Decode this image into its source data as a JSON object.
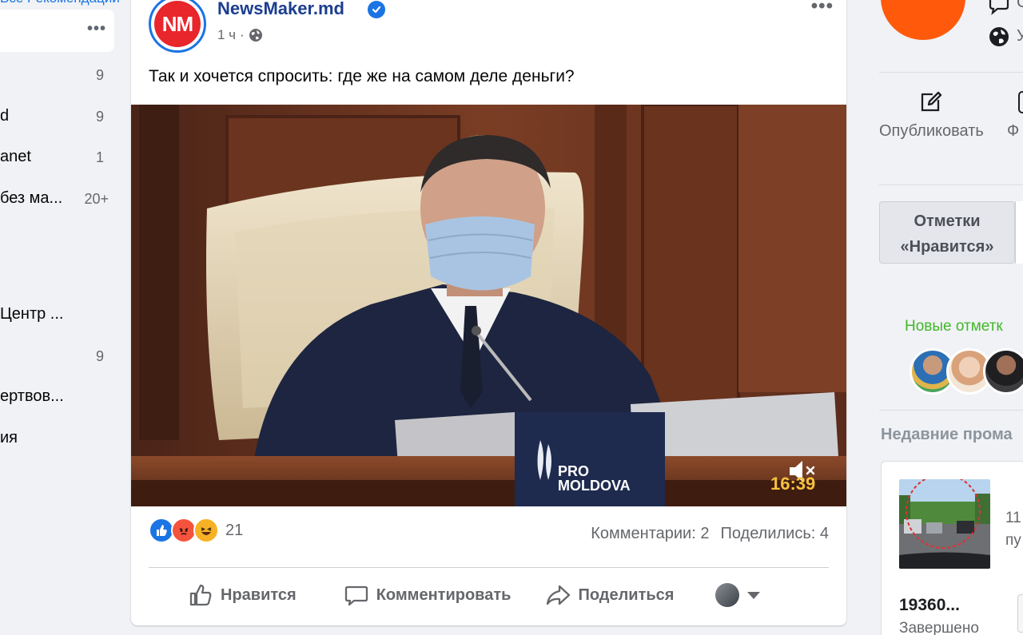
{
  "left_sidebar": {
    "top_link": "Все Рекомендации",
    "items": [
      {
        "label": "",
        "count": "9"
      },
      {
        "label": "d",
        "count": "9"
      },
      {
        "label": "anet",
        "count": "1"
      },
      {
        "label": "без ма...",
        "count": "20+"
      },
      {
        "label": "Центр ...",
        "count": ""
      },
      {
        "label": "",
        "count": "9"
      },
      {
        "label": "ертвов...",
        "count": ""
      },
      {
        "label": "ия",
        "count": ""
      }
    ]
  },
  "post": {
    "page_name": "NewsMaker.md",
    "avatar_text": "NM",
    "time": "1 ч",
    "text": "Так и хочется спросить: где же на самом деле деньги?",
    "video": {
      "timestamp": "16:39",
      "nameplate_line1": "PRO",
      "nameplate_line2": "MOLDOVA"
    },
    "reactions_count": "21",
    "comments": "Комментарии: 2",
    "shares": "Поделились: 4",
    "actions": {
      "like": "Нравится",
      "comment": "Комментировать",
      "share": "Поделиться"
    }
  },
  "right_column": {
    "row1_text": "С",
    "row2_text": "У",
    "publish_label": "Опубликовать",
    "photo_label": "Ф",
    "likes_tab": "Отметки «Нравится»",
    "new_likes": "Новые отметк",
    "recent_promotions": "Недавние прома",
    "promo": {
      "side_line1": "11",
      "side_line2": "пу",
      "number": "19360...",
      "status": "Завершено"
    }
  }
}
